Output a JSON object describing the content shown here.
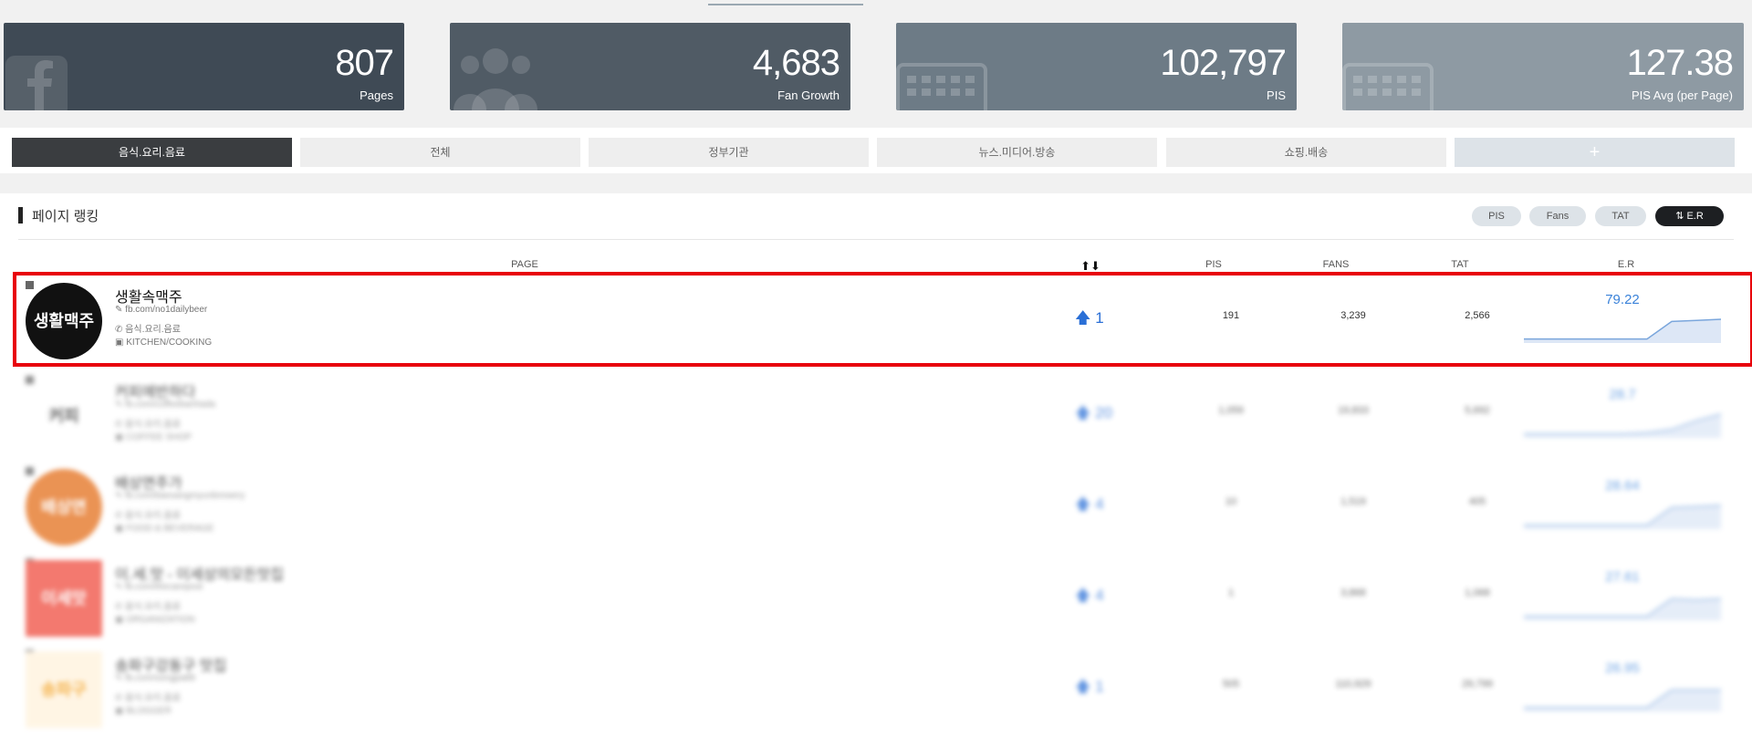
{
  "stats": [
    {
      "value": "807",
      "label": "Pages",
      "icon": "facebook-icon",
      "color": "#3f4a55"
    },
    {
      "value": "4,683",
      "label": "Fan Growth",
      "icon": "users-icon",
      "color": "#505b65"
    },
    {
      "value": "102,797",
      "label": "PIS",
      "icon": "keyboard-icon",
      "color": "#6d7b86"
    },
    {
      "value": "127.38",
      "label": "PIS Avg (per Page)",
      "icon": "keyboard-icon",
      "color": "#8e9aa3"
    }
  ],
  "tabs": [
    "음식.요리.음료",
    "전체",
    "정부기관",
    "뉴스.미디어.방송",
    "쇼핑.배송",
    "+"
  ],
  "section_title": "페이지 랭킹",
  "sort_buttons": [
    "PIS",
    "Fans",
    "TAT",
    "E.R"
  ],
  "columns": {
    "page": "PAGE",
    "rank": "",
    "pis": "PIS",
    "fans": "FANS",
    "tat": "TAT",
    "er": "E.R"
  },
  "rows": [
    {
      "name": "생활속맥주",
      "url": "fb.com/no1dailybeer",
      "category": "음식.요리.음료",
      "type": "KITCHEN/COOKING",
      "rank": "1",
      "pis": "191",
      "fans": "3,239",
      "tat": "2,566",
      "er": "79.22",
      "er_trend": [
        0.1,
        0.1,
        0.1,
        0.1,
        0.1,
        0.1,
        0.9,
        0.95,
        1.0
      ],
      "logo_text": "생활맥주",
      "logo_bg": "#111111",
      "logo_fg": "#ffffff"
    },
    {
      "name": "커피에반하다",
      "url": "fb.com/coffeebanhada",
      "category": "음식.요리.음료",
      "type": "COFFEE SHOP",
      "rank": "20",
      "pis": "1,059",
      "fans": "19,833",
      "tat": "5,692",
      "er": "28.7",
      "er_trend": [
        0.1,
        0.1,
        0.1,
        0.1,
        0.1,
        0.15,
        0.3,
        0.7,
        1.0
      ],
      "logo_text": "커피",
      "logo_bg": "#ffffff",
      "logo_fg": "#333333"
    },
    {
      "name": "배상면주가",
      "url": "fb.com/baesangmyunbrewery",
      "category": "음식.요리.음료",
      "type": "FOOD & BEVERAGE",
      "rank": "4",
      "pis": "10",
      "fans": "1,519",
      "tat": "405",
      "er": "28.64",
      "er_trend": [
        0.1,
        0.1,
        0.1,
        0.1,
        0.1,
        0.1,
        0.9,
        0.95,
        1.0
      ],
      "logo_text": "배상면",
      "logo_bg": "#e46f1b",
      "logo_fg": "#ffffff"
    },
    {
      "name": "이.세.맛 - 이세상의모든맛집",
      "url": "fb.com/thecarepost",
      "category": "음식.요리.음료",
      "type": "ORGANIZATION",
      "rank": "4",
      "pis": "1",
      "fans": "3,868",
      "tat": "1,068",
      "er": "27.61",
      "er_trend": [
        0.1,
        0.1,
        0.1,
        0.1,
        0.1,
        0.1,
        0.9,
        0.85,
        0.9
      ],
      "logo_text": "이세맛",
      "logo_bg": "#ef4d3f",
      "logo_fg": "#ffffff"
    },
    {
      "name": "송파구강동구 맛집",
      "url": "fb.com/songpa88",
      "category": "음식.요리.음료",
      "type": "BLOGGER",
      "rank": "1",
      "pis": "505",
      "fans": "110,929",
      "tat": "29,799",
      "er": "26.95",
      "er_trend": [
        0.1,
        0.1,
        0.1,
        0.1,
        0.1,
        0.1,
        0.9,
        0.9,
        0.9
      ],
      "logo_text": "송파구",
      "logo_bg": "#fff2dc",
      "logo_fg": "#f29a12"
    }
  ]
}
